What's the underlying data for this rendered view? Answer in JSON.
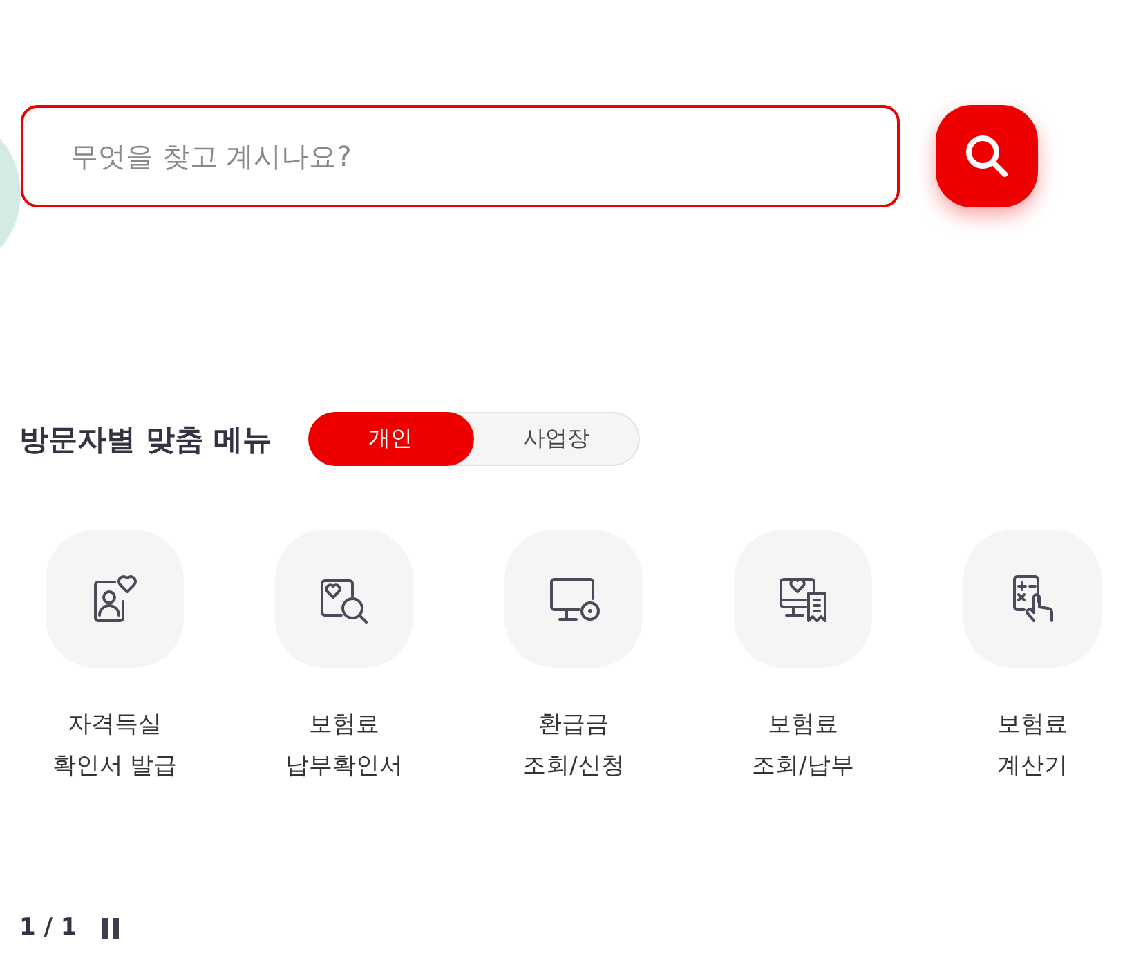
{
  "search": {
    "placeholder": "무엇을 찾고 계시나요?"
  },
  "menu": {
    "title": "방문자별 맞춤 메뉴",
    "tabs": [
      {
        "label": "개인",
        "selected": true
      },
      {
        "label": "사업장",
        "selected": false
      }
    ],
    "items": [
      {
        "kind": "certificate",
        "lines": [
          "자격득실",
          "확인서 발급"
        ]
      },
      {
        "kind": "search-doc",
        "lines": [
          "보험료",
          "납부확인서"
        ]
      },
      {
        "kind": "monitor-coin",
        "lines": [
          "환급금",
          "조회/신청"
        ]
      },
      {
        "kind": "monitor-receipt",
        "lines": [
          "보험료",
          "조회/납부"
        ]
      },
      {
        "kind": "calculator",
        "lines": [
          "보험료",
          "계산기"
        ]
      }
    ]
  },
  "pager": {
    "text": "1 / 1"
  }
}
